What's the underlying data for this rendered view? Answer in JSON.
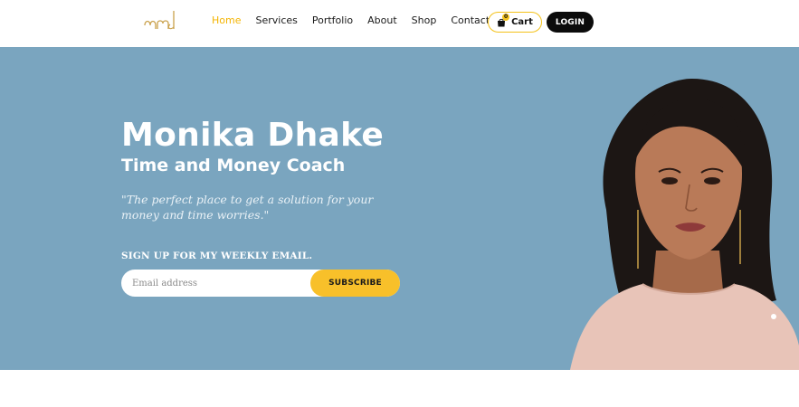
{
  "header": {
    "logo_icon": "md-monogram-logo",
    "nav": [
      {
        "label": "Home",
        "active": true
      },
      {
        "label": "Services",
        "active": false
      },
      {
        "label": "Portfolio",
        "active": false
      },
      {
        "label": "About",
        "active": false
      },
      {
        "label": "Shop",
        "active": false
      },
      {
        "label": "Contact",
        "active": false
      }
    ],
    "cart_label": "Cart",
    "cart_count": "0",
    "login_label": "LOGIN"
  },
  "hero": {
    "name": "Monika Dhake",
    "subtitle": "Time and Money Coach",
    "quote": "\"The perfect place to get a solution for your money and time worries.\"",
    "signup_label": "SIGN UP FOR MY WEEKLY EMAIL.",
    "email_placeholder": "Email address",
    "subscribe_label": "SUBSCRIBE"
  },
  "colors": {
    "accent": "#f4b400",
    "hero_bg": "#7aa5bf",
    "button_dark": "#0b0b0b",
    "subscribe_bg": "#f8c02a"
  }
}
